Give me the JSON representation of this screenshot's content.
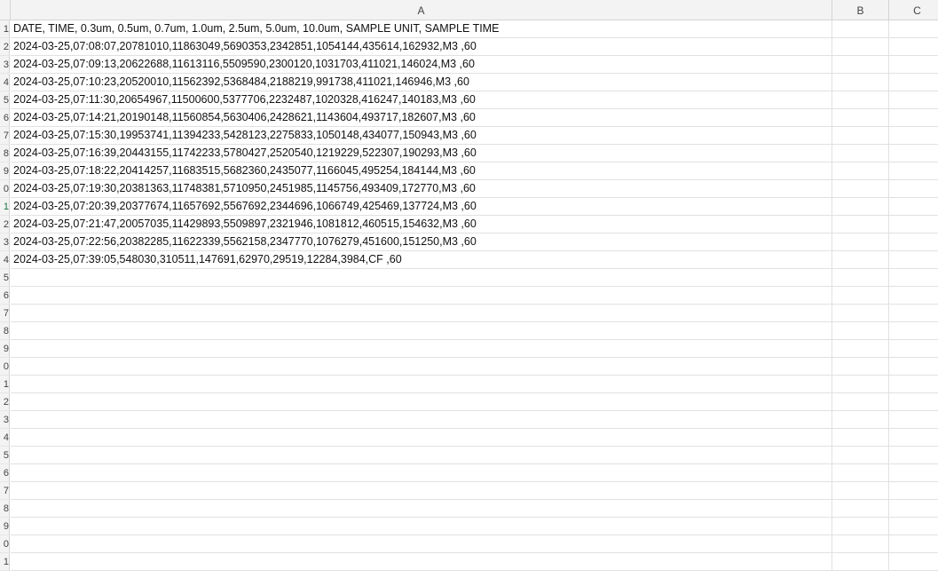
{
  "columns": [
    "A",
    "B",
    "C"
  ],
  "row_numbers": [
    "1",
    "2",
    "3",
    "4",
    "5",
    "6",
    "7",
    "8",
    "9",
    "0",
    "1",
    "2",
    "3",
    "4",
    "5",
    "6",
    "7",
    "8",
    "9",
    "0",
    "1",
    "2",
    "3",
    "4",
    "5",
    "6",
    "7",
    "8",
    "9",
    "0",
    "1"
  ],
  "rows": [
    "DATE, TIME, 0.3um, 0.5um, 0.7um, 1.0um, 2.5um, 5.0um, 10.0um, SAMPLE UNIT, SAMPLE TIME",
    "2024-03-25,07:08:07,20781010,11863049,5690353,2342851,1054144,435614,162932,M3 ,60",
    "2024-03-25,07:09:13,20622688,11613116,5509590,2300120,1031703,411021,146024,M3 ,60",
    "2024-03-25,07:10:23,20520010,11562392,5368484,2188219,991738,411021,146946,M3 ,60",
    "2024-03-25,07:11:30,20654967,11500600,5377706,2232487,1020328,416247,140183,M3 ,60",
    "2024-03-25,07:14:21,20190148,11560854,5630406,2428621,1143604,493717,182607,M3 ,60",
    "2024-03-25,07:15:30,19953741,11394233,5428123,2275833,1050148,434077,150943,M3 ,60",
    "2024-03-25,07:16:39,20443155,11742233,5780427,2520540,1219229,522307,190293,M3 ,60",
    "2024-03-25,07:18:22,20414257,11683515,5682360,2435077,1166045,495254,184144,M3 ,60",
    "2024-03-25,07:19:30,20381363,11748381,5710950,2451985,1145756,493409,172770,M3 ,60",
    "2024-03-25,07:20:39,20377674,11657692,5567692,2344696,1066749,425469,137724,M3 ,60",
    "2024-03-25,07:21:47,20057035,11429893,5509897,2321946,1081812,460515,154632,M3 ,60",
    "2024-03-25,07:22:56,20382285,11622339,5562158,2347770,1076279,451600,151250,M3 ,60",
    "2024-03-25,07:39:05,548030,310511,147691,62970,29519,12284,3984,CF ,60",
    "",
    "",
    "",
    "",
    "",
    "",
    "",
    "",
    "",
    "",
    "",
    "",
    "",
    "",
    "",
    "",
    ""
  ]
}
